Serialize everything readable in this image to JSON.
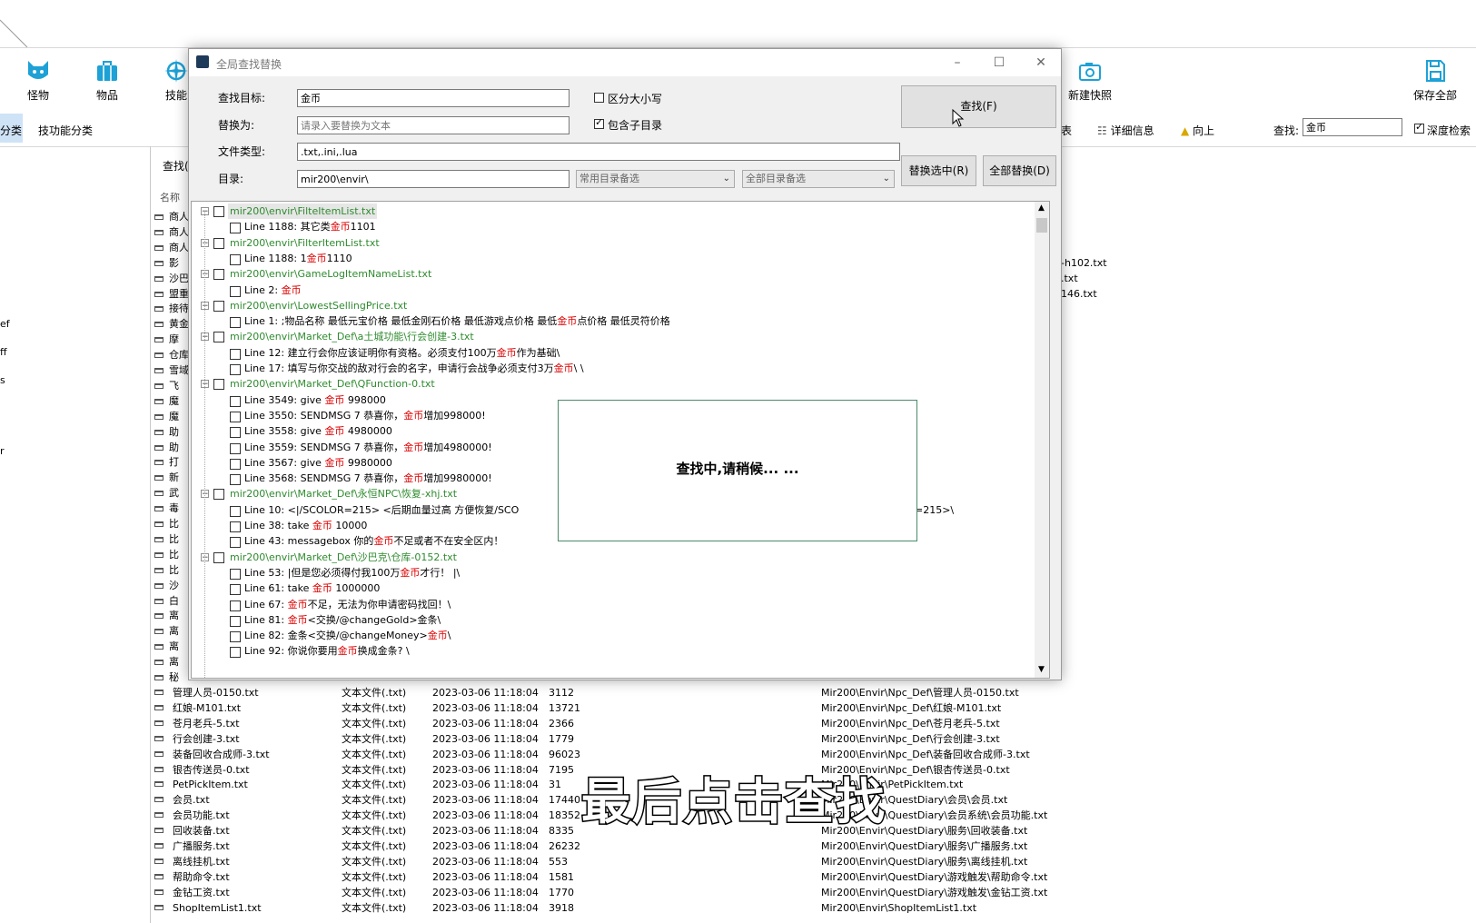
{
  "toolbar": {
    "monster": "怪物",
    "items": "物品",
    "skills": "技能",
    "new_snapshot": "新建快照",
    "save_all": "保存全部"
  },
  "category_bar": {
    "active_tab": "分类",
    "skill_category": "技功能分类",
    "list_view": "表",
    "detail_info": "详细信息",
    "up": "向上",
    "search_label": "查找:",
    "search_value": "金币",
    "deep_search": "深度检索"
  },
  "panel": {
    "search_label": "查找(",
    "name_header": "名称"
  },
  "left_fragments": [
    "ef",
    "ff",
    "s",
    "r"
  ],
  "name_fragments": [
    "商人",
    "商人",
    "商人",
    "影",
    "沙巴",
    "盟重",
    "接待",
    "黄金",
    "摩",
    "仓库",
    "雪域",
    "飞",
    "魔",
    "魔",
    "助",
    "助",
    "打",
    "新",
    "武",
    "毒",
    "比",
    "比",
    "比",
    "比",
    "沙",
    "白",
    "离",
    "离",
    "离",
    "离",
    "秘"
  ],
  "right_fragments": [
    "-h102.txt",
    ".txt",
    "146.txt"
  ],
  "file_list": [
    {
      "name": "管理人员-0150.txt",
      "type": "文本文件(.txt)",
      "date": "2023-03-06 11:18:04",
      "size": "3112",
      "path": "Mir200\\Envir\\Npc_Def\\管理人员-0150.txt"
    },
    {
      "name": "红娘-M101.txt",
      "type": "文本文件(.txt)",
      "date": "2023-03-06 11:18:04",
      "size": "13721",
      "path": "Mir200\\Envir\\Npc_Def\\红娘-M101.txt"
    },
    {
      "name": "苍月老兵-5.txt",
      "type": "文本文件(.txt)",
      "date": "2023-03-06 11:18:04",
      "size": "2366",
      "path": "Mir200\\Envir\\Npc_Def\\苍月老兵-5.txt"
    },
    {
      "name": "行会创建-3.txt",
      "type": "文本文件(.txt)",
      "date": "2023-03-06 11:18:04",
      "size": "1779",
      "path": "Mir200\\Envir\\Npc_Def\\行会创建-3.txt"
    },
    {
      "name": "装备回收合成师-3.txt",
      "type": "文本文件(.txt)",
      "date": "2023-03-06 11:18:04",
      "size": "96023",
      "path": "Mir200\\Envir\\Npc_Def\\装备回收合成师-3.txt"
    },
    {
      "name": "银杏传送员-0.txt",
      "type": "文本文件(.txt)",
      "date": "2023-03-06 11:18:04",
      "size": "7195",
      "path": "Mir200\\Envir\\Npc_Def\\银杏传送员-0.txt"
    },
    {
      "name": "PetPickItem.txt",
      "type": "文本文件(.txt)",
      "date": "2023-03-06 11:18:04",
      "size": "31",
      "path": "Mir200\\Envir\\PetPickItem.txt"
    },
    {
      "name": "会员.txt",
      "type": "文本文件(.txt)",
      "date": "2023-03-06 11:18:04",
      "size": "17440",
      "path": "Mir200\\Envir\\QuestDiary\\会员\\会员.txt"
    },
    {
      "name": "会员功能.txt",
      "type": "文本文件(.txt)",
      "date": "2023-03-06 11:18:04",
      "size": "18352",
      "path": "Mir200\\Envir\\QuestDiary\\会员系统\\会员功能.txt"
    },
    {
      "name": "回收装备.txt",
      "type": "文本文件(.txt)",
      "date": "2023-03-06 11:18:04",
      "size": "8335",
      "path": "Mir200\\Envir\\QuestDiary\\服务\\回收装备.txt"
    },
    {
      "name": "广播服务.txt",
      "type": "文本文件(.txt)",
      "date": "2023-03-06 11:18:04",
      "size": "26232",
      "path": "Mir200\\Envir\\QuestDiary\\服务\\广播服务.txt"
    },
    {
      "name": "离线挂机.txt",
      "type": "文本文件(.txt)",
      "date": "2023-03-06 11:18:04",
      "size": "553",
      "path": "Mir200\\Envir\\QuestDiary\\服务\\离线挂机.txt"
    },
    {
      "name": "帮助命令.txt",
      "type": "文本文件(.txt)",
      "date": "2023-03-06 11:18:04",
      "size": "1581",
      "path": "Mir200\\Envir\\QuestDiary\\游戏触发\\帮助命令.txt"
    },
    {
      "name": "金钻工资.txt",
      "type": "文本文件(.txt)",
      "date": "2023-03-06 11:18:04",
      "size": "1770",
      "path": "Mir200\\Envir\\QuestDiary\\游戏触发\\金钻工资.txt"
    },
    {
      "name": "ShopItemList1.txt",
      "type": "文本文件(.txt)",
      "date": "2023-03-06 11:18:04",
      "size": "3918",
      "path": "Mir200\\Envir\\ShopItemList1.txt"
    }
  ],
  "dialog": {
    "title": "全局查找替换",
    "find_label": "查找目标:",
    "find_value": "金币",
    "replace_label": "替换为:",
    "replace_placeholder": "请录入要替换为文本",
    "filetype_label": "文件类型:",
    "filetype_value": ".txt,.ini,.lua",
    "dir_label": "目录:",
    "dir_value": "mir200\\envir\\",
    "case_sensitive": "区分大小写",
    "include_subdirs": "包含子目录",
    "common_dirs": "常用目录备选",
    "all_dirs": "全部目录备选",
    "find_button": "查找(F)",
    "replace_selected_button": "替换选中(R)",
    "replace_all_button": "全部替换(D)"
  },
  "results": [
    {
      "file": "mir200\\envir\\FilteItemList.txt",
      "selected": true,
      "lines": [
        {
          "pre": "Line 1188: 其它类",
          "hit": "金币",
          "post": "1101"
        }
      ]
    },
    {
      "file": "mir200\\envir\\FilterItemList.txt",
      "lines": [
        {
          "pre": "Line 1188: 1",
          "hit": "金币",
          "post": "1110"
        }
      ]
    },
    {
      "file": "mir200\\envir\\GameLogItemNameList.txt",
      "lines": [
        {
          "pre": "Line 2: ",
          "hit": "金币",
          "post": ""
        }
      ]
    },
    {
      "file": "mir200\\envir\\LowestSellingPrice.txt",
      "lines": [
        {
          "pre": "Line 1: ;物品名称  最低元宝价格  最低金刚石价格  最低游戏点价格  最低",
          "hit": "金币",
          "post": "点价格  最低灵符价格"
        }
      ]
    },
    {
      "file": "mir200\\envir\\Market_Def\\a土城功能\\行会创建-3.txt",
      "lines": [
        {
          "pre": "Line 12: 建立行会你应该证明你有资格。必须支付100万",
          "hit": "金币",
          "post": "作为基础\\"
        },
        {
          "pre": "Line 17: 填写与你交战的敌对行会的名字，申请行会战争必须支付3万",
          "hit": "金币",
          "post": "\\ \\"
        }
      ]
    },
    {
      "file": "mir200\\envir\\Market_Def\\QFunction-0.txt",
      "lines": [
        {
          "pre": "Line 3549: give ",
          "hit": "金币",
          "post": " 998000"
        },
        {
          "pre": "Line 3550: SENDMSG 7 恭喜你，",
          "hit": "金币",
          "post": "增加998000!"
        },
        {
          "pre": "Line 3558: give ",
          "hit": "金币",
          "post": " 4980000"
        },
        {
          "pre": "Line 3559: SENDMSG 7 恭喜你，",
          "hit": "金币",
          "post": "增加4980000!"
        },
        {
          "pre": "Line 3567: give ",
          "hit": "金币",
          "post": " 9980000"
        },
        {
          "pre": "Line 3568: SENDMSG 7 恭喜你，",
          "hit": "金币",
          "post": "增加9980000!"
        }
      ]
    },
    {
      "file": "mir200\\envir\\Market_Def\\永恒NPC\\恢复-xhj.txt",
      "lines": [
        {
          "pre": "Line 10: <|/SCOLOR=215>              <后期血量过高    方便恢复/SCO",
          "hit": "",
          "post": ""
        },
        {
          "pre": "Line 38: take ",
          "hit": "金币",
          "post": " 10000"
        },
        {
          "pre": "Line 43: messagebox 你的",
          "hit": "金币",
          "post": "不足或者不在安全区内！"
        }
      ]
    },
    {
      "file": "mir200\\envir\\Market_Def\\沙巴克\\仓库-0152.txt",
      "lines": [
        {
          "pre": "Line 53: |但是您必须得付我100万",
          "hit": "金币",
          "post": "才行！        |\\"
        },
        {
          "pre": "Line 61: take ",
          "hit": "金币",
          "post": " 1000000"
        },
        {
          "pre": "Line 67: ",
          "hit": "金币",
          "post": "不足，无法为你申请密码找回！\\"
        },
        {
          "pre": "Line 81: ",
          "hit": "金币",
          "post": "<交换/@changeGold>金条\\"
        },
        {
          "pre": "Line 82: 金条<交换/@changeMoney>",
          "hit": "金币",
          "post": "\\"
        },
        {
          "pre": "Line 92: 你说你要用",
          "hit": "金币",
          "post": "换成金条? \\"
        }
      ]
    }
  ],
  "overflow_text": "=215>\\",
  "progress_popup": "查找中,请稍候... ...",
  "caption": "最后点击查找"
}
